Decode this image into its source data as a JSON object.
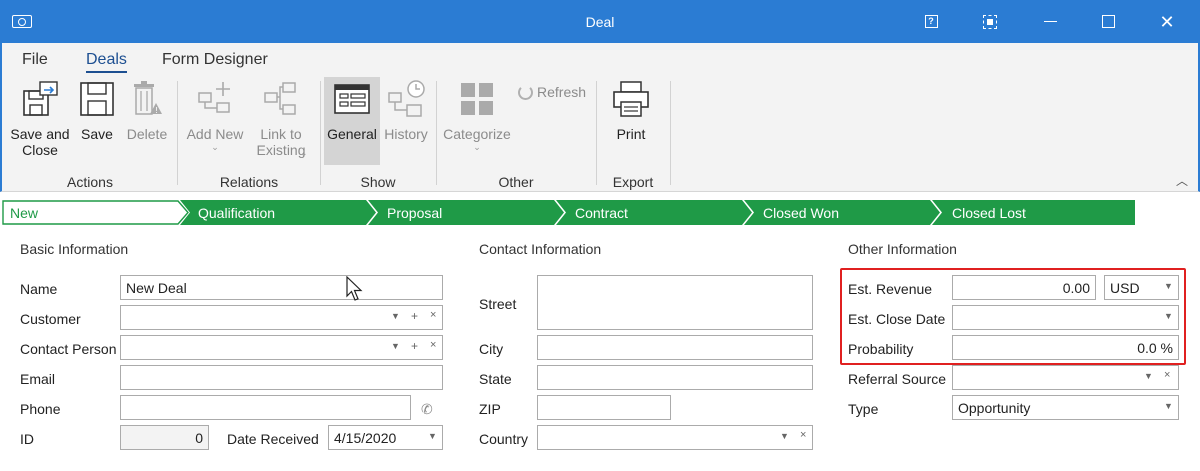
{
  "window": {
    "title": "Deal",
    "controls": [
      "help",
      "fit",
      "minimize",
      "maximize",
      "close"
    ]
  },
  "ribbon_tabs": [
    "File",
    "Deals",
    "Form Designer"
  ],
  "active_tab": "Deals",
  "ribbon": {
    "actions": {
      "label": "Actions",
      "save_close": "Save and Close",
      "save": "Save",
      "delete": "Delete"
    },
    "relations": {
      "label": "Relations",
      "add_new": "Add New",
      "link_to_existing": "Link to Existing"
    },
    "show": {
      "label": "Show",
      "general": "General",
      "history": "History"
    },
    "other": {
      "label": "Other",
      "categorize": "Categorize",
      "refresh": "Refresh"
    },
    "export": {
      "label": "Export",
      "print": "Print"
    }
  },
  "stages": [
    "New",
    "Qualification",
    "Proposal",
    "Contract",
    "Closed Won",
    "Closed Lost"
  ],
  "colors": {
    "titlebar": "#2b7cd3",
    "stage": "#1f9a47",
    "highlight": "#e02020"
  },
  "basic_info": {
    "title": "Basic Information",
    "name_label": "Name",
    "name_value": "New Deal",
    "customer_label": "Customer",
    "customer_value": "",
    "contact_label": "Contact Person",
    "contact_value": "",
    "email_label": "Email",
    "email_value": "",
    "phone_label": "Phone",
    "phone_value": "",
    "id_label": "ID",
    "id_value": "0",
    "date_label": "Date Received",
    "date_value": "4/15/2020"
  },
  "contact_info": {
    "title": "Contact Information",
    "street_label": "Street",
    "street_value": "",
    "city_label": "City",
    "city_value": "",
    "state_label": "State",
    "state_value": "",
    "zip_label": "ZIP",
    "zip_value": "",
    "country_label": "Country",
    "country_value": ""
  },
  "other_info": {
    "title": "Other Information",
    "revenue_label": "Est. Revenue",
    "revenue_value": "0.00",
    "currency_value": "USD",
    "close_date_label": "Est. Close Date",
    "close_date_value": "",
    "probability_label": "Probability",
    "probability_value": "0.0 %",
    "referral_label": "Referral Source",
    "referral_value": "",
    "type_label": "Type",
    "type_value": "Opportunity"
  }
}
